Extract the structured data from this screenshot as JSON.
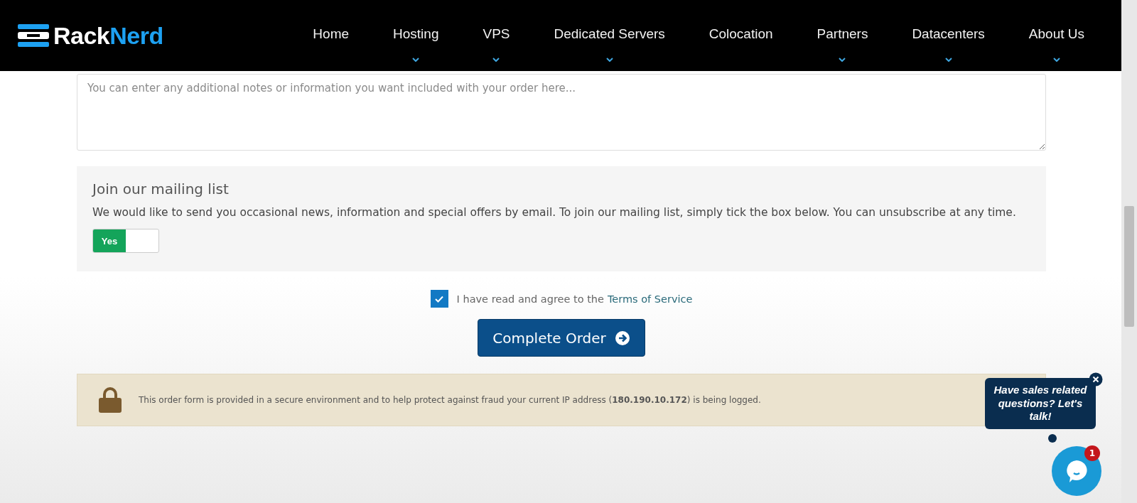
{
  "logo": {
    "parts": [
      "Rack",
      "Nerd"
    ]
  },
  "nav": [
    {
      "label": "Home",
      "has_dropdown": false
    },
    {
      "label": "Hosting",
      "has_dropdown": true
    },
    {
      "label": "VPS",
      "has_dropdown": true
    },
    {
      "label": "Dedicated Servers",
      "has_dropdown": true
    },
    {
      "label": "Colocation",
      "has_dropdown": false
    },
    {
      "label": "Partners",
      "has_dropdown": true
    },
    {
      "label": "Datacenters",
      "has_dropdown": true
    },
    {
      "label": "About Us",
      "has_dropdown": true
    }
  ],
  "notes": {
    "placeholder": "You can enter any additional notes or information you want included with your order here..."
  },
  "mailing": {
    "title": "Join our mailing list",
    "text": "We would like to send you occasional news, information and special offers by email. To join our mailing list, simply tick the box below. You can unsubscribe at any time.",
    "toggle": {
      "label": "Yes",
      "on": true
    }
  },
  "terms": {
    "checked": true,
    "text": "I have read and agree to the",
    "link": "Terms of Service"
  },
  "submit": "Complete Order",
  "secure_notice": "This order form is provided in a secure environment and to help protect against fraud your current IP address (**180.190.10.172**) is being logged.",
  "chat": {
    "bubble": "Have sales related questions? Let's talk!",
    "badge": "1"
  }
}
